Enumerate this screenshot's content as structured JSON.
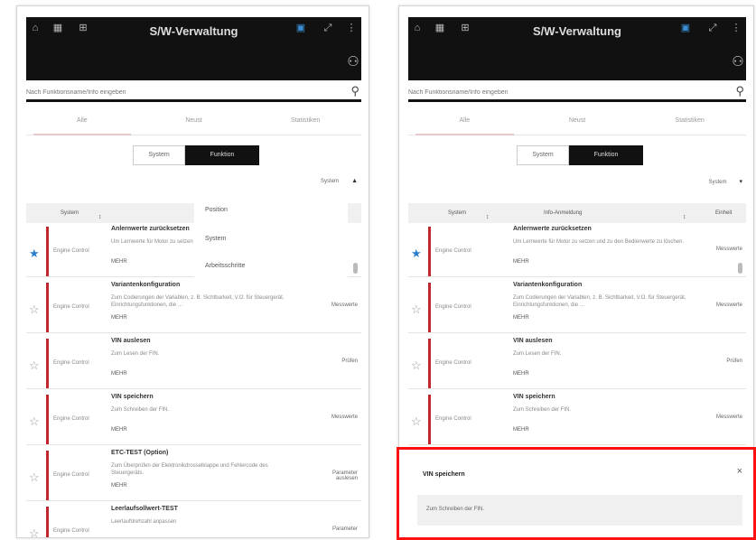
{
  "app": {
    "title": "S/W-Verwaltung",
    "search_placeholder": "Nach Funktionsname/Info eingeben",
    "tabs": [
      "Alle",
      "Neust",
      "Statistiken"
    ],
    "segment": [
      "System",
      "Funktion"
    ],
    "sort_label": "System",
    "columns_left": [
      "System",
      "Funktion",
      "Position"
    ],
    "columns_right": [
      "System",
      "Info-Anmeldung",
      "Einheit"
    ]
  },
  "context_menu": [
    "Position",
    "System",
    "Arbeitsschritte"
  ],
  "rows": [
    {
      "type": "Engine Control",
      "title": "Anlernwerte zurücksetzen",
      "desc": "Um Lernwerte für Motor zu setzen und zu den Bedienwerte zu löschen.",
      "more": "MEHR",
      "right": "Messwerte",
      "fav": true
    },
    {
      "type": "Engine Control",
      "title": "Variantenkonfiguration",
      "desc": "Zum Codierungen der Variablen, z. B. Sichtbarkeit, V.O. für Steuergerät, Einrichtungsfunktionen, die …",
      "more": "MEHR",
      "right": "Messwerte",
      "fav": false
    },
    {
      "type": "Engine Control",
      "title": "VIN auslesen",
      "desc": "Zum Lesen der FIN.",
      "more": "MEHR",
      "right": "Prüfen",
      "fav": false
    },
    {
      "type": "Engine Control",
      "title": "VIN speichern",
      "desc": "Zum Schreiben der FIN.",
      "more": "MEHR",
      "right": "Messwerte",
      "fav": false
    },
    {
      "type": "Engine Control",
      "title": "ETC-TEST (Option)",
      "desc": "Zum Überprüfen der Elektronikdrosselklappe und Fehlercode des Steuergeräts.",
      "more": "MEHR",
      "right": "Parameter auslesen",
      "fav": false
    },
    {
      "type": "Engine Control",
      "title": "Leerlaufsollwert-TEST",
      "desc": "Leerlaufdrehzahl anpassen",
      "more": "",
      "right": "Parameter",
      "fav": false
    }
  ],
  "detail": {
    "title": "VIN speichern",
    "close": "×",
    "desc": "Zum Schreiben der FIN."
  },
  "icons": {
    "star_filled": "★",
    "star_empty": "☆",
    "search": "⚲",
    "close": "×"
  },
  "colors": {
    "accent_red": "#c0262c",
    "fav_blue": "#2b7fd1",
    "topbar": "#111111",
    "highlight": "#ff1010"
  }
}
